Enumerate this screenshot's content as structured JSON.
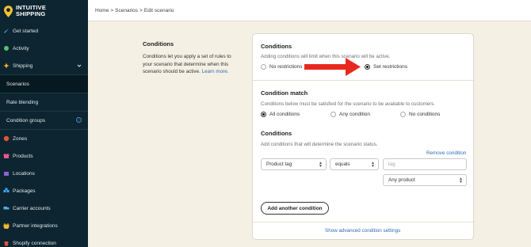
{
  "brand": {
    "line1": "INTUITIVE",
    "line2": "SHIPPING"
  },
  "breadcrumb": {
    "home": "Home",
    "scenarios": "Scenarios",
    "current": "Edit scenario",
    "separator": ">"
  },
  "sidebar": {
    "items": [
      {
        "label": "Get started",
        "icon": "rocket-icon"
      },
      {
        "label": "Activity",
        "icon": "activity-icon"
      },
      {
        "label": "Shipping",
        "icon": "shipping-icon"
      },
      {
        "label": "Scenarios"
      },
      {
        "label": "Rate blending"
      },
      {
        "label": "Condition groups"
      },
      {
        "label": "Zones",
        "icon": "globe-icon"
      },
      {
        "label": "Products",
        "icon": "shirt-icon"
      },
      {
        "label": "Locations",
        "icon": "building-icon"
      },
      {
        "label": "Packages",
        "icon": "boxes-icon"
      },
      {
        "label": "Carrier accounts",
        "icon": "truck-icon"
      },
      {
        "label": "Partner integrations",
        "icon": "plug-icon"
      },
      {
        "label": "Shopify connection",
        "icon": "shopify-icon"
      }
    ]
  },
  "description": {
    "title": "Conditions",
    "text": "Conditions let you apply a set of rules to your scenario that determine when this scenario should be active.",
    "link": "Learn more."
  },
  "card": {
    "conditions": {
      "title": "Conditions",
      "subtitle": "Adding conditions will limit when this scenario will be active.",
      "options": [
        "No restrictions",
        "Set restrictions"
      ],
      "selected": "Set restrictions"
    },
    "match": {
      "title": "Condition match",
      "subtitle": "Conditions below must be satisfied for the scenario to be available to customers.",
      "options": [
        "All conditions",
        "Any condition",
        "No conditions"
      ],
      "selected": "All conditions"
    },
    "rules": {
      "title": "Conditions",
      "subtitle": "Add conditions that will determine the scenario status.",
      "remove": "Remove condition",
      "field": "Product tag",
      "operator": "equals",
      "value_placeholder": "tag",
      "scope": "Any product"
    },
    "add_button": "Add another condition",
    "advanced_link": "Show advanced condition settings"
  },
  "colors": {
    "sidebar": "#0d2530",
    "accent_link": "#2f6bb5",
    "arrow": "#e8281f",
    "background": "#f5f0e4"
  }
}
